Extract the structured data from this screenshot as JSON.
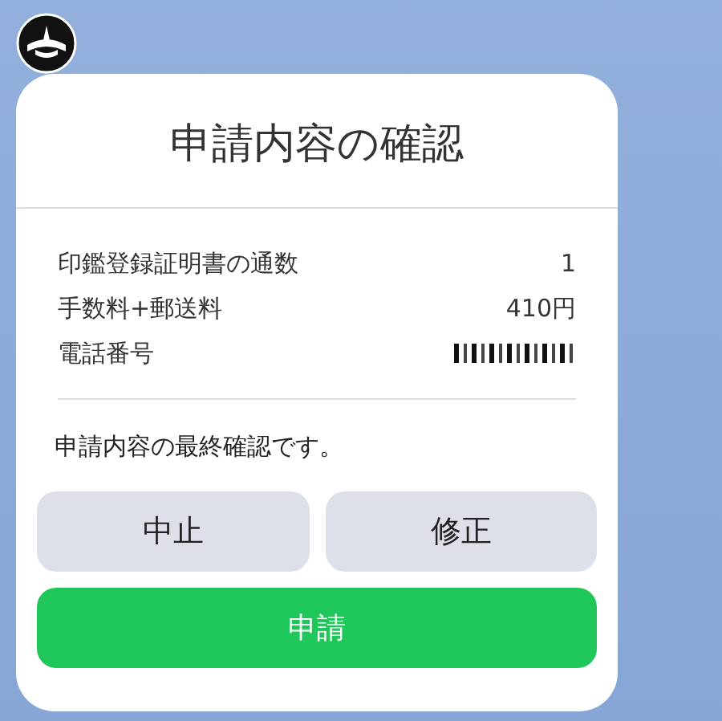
{
  "title": "申請内容の確認",
  "rows": [
    {
      "kind": "text",
      "label": "印鑑登録証明書の通数",
      "value": "1"
    },
    {
      "kind": "text",
      "label": "手数料+郵送料",
      "value": "410円"
    },
    {
      "kind": "redacted",
      "label": "電話番号"
    }
  ],
  "message": "申請内容の最終確認です。",
  "buttons": [
    {
      "kind": "secondary",
      "label": "中止"
    },
    {
      "kind": "secondary",
      "label": "修正"
    },
    {
      "kind": "primary",
      "label": "申請"
    }
  ]
}
